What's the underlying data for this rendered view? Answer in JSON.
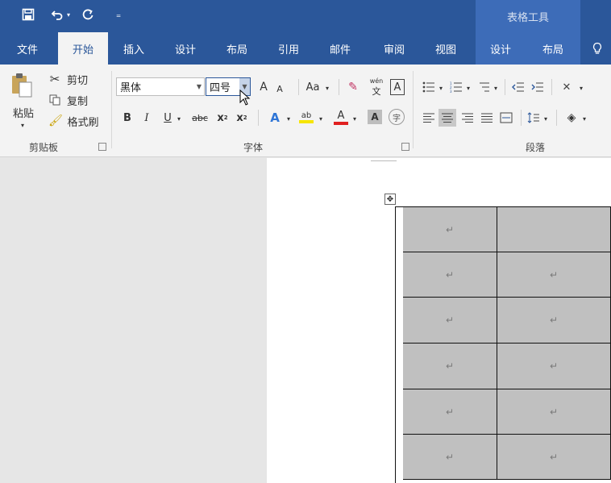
{
  "qat": {
    "save_icon": "save-icon",
    "undo_icon": "undo-icon",
    "redo_icon": "redo-icon",
    "customize_icon": "customize-qat-icon",
    "contextual_title": "表格工具"
  },
  "tabs": [
    {
      "label": "文件"
    },
    {
      "label": "开始",
      "active": true
    },
    {
      "label": "插入"
    },
    {
      "label": "设计"
    },
    {
      "label": "布局"
    },
    {
      "label": "引用"
    },
    {
      "label": "邮件"
    },
    {
      "label": "审阅"
    },
    {
      "label": "视图"
    },
    {
      "label": "设计",
      "contextual": true
    },
    {
      "label": "布局",
      "contextual": true
    }
  ],
  "tell_me_icon": "lightbulb-icon",
  "clipboard": {
    "paste": "粘贴",
    "cut": "剪切",
    "copy": "复制",
    "format_painter": "格式刷",
    "group_label": "剪贴板"
  },
  "font": {
    "font_name": "黑体",
    "font_size": "四号",
    "grow": "A",
    "shrink": "A",
    "case": "Aa",
    "phonetic": "wén",
    "phonetic_char": "文",
    "border_char": "A",
    "bold": "B",
    "italic": "I",
    "underline": "U",
    "strike": "abc",
    "subscript": "x",
    "superscript": "x",
    "effects": "A",
    "highlight": "ab",
    "font_color": "A",
    "shading": "A",
    "enclose": "字",
    "group_label": "字体"
  },
  "paragraph": {
    "group_label": "段落"
  },
  "table": {
    "rows": [
      [
        "↵",
        ""
      ],
      [
        "↵",
        "↵"
      ],
      [
        "↵",
        "↵"
      ],
      [
        "↵",
        "↵"
      ],
      [
        "↵",
        "↵"
      ],
      [
        "↵",
        "↵"
      ]
    ],
    "move_handle": "✥"
  },
  "colors": {
    "ribbon_blue": "#2b579a",
    "contextual_blue": "#3d6cb8",
    "cell_gray": "#c0c0c0",
    "highlight_yellow": "#f6e500",
    "font_red": "#e02020"
  }
}
